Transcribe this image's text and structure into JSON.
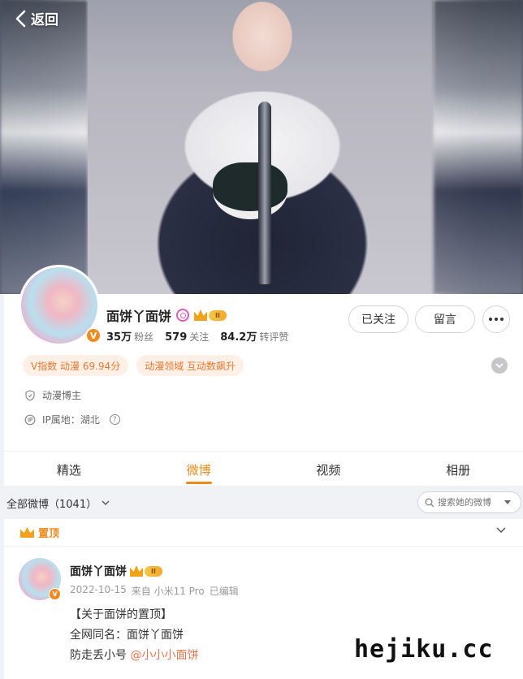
{
  "nav": {
    "back_label": "返回"
  },
  "profile": {
    "name": "面饼丫面饼",
    "verified_mark": "V",
    "vip_level": "II",
    "stats": [
      {
        "value": "35万",
        "label": "粉丝"
      },
      {
        "value": "579",
        "label": "关注"
      },
      {
        "value": "84.2万",
        "label": "转评赞"
      }
    ],
    "follow_button": "已关注",
    "message_button": "留言",
    "tags": [
      "V指数 动漫 69.94分",
      "动漫领域 互动数飙升"
    ],
    "role": "动漫博主",
    "ip_location": "IP属地：湖北",
    "help_mark": "?"
  },
  "tabs": [
    {
      "label": "精选",
      "active": false
    },
    {
      "label": "微博",
      "active": true
    },
    {
      "label": "视频",
      "active": false
    },
    {
      "label": "相册",
      "active": false
    }
  ],
  "filter": {
    "all_posts_label": "全部微博（1041）",
    "search_placeholder": "搜索她的微博"
  },
  "pinned_post": {
    "section_label": "置顶",
    "author": "面饼丫面饼",
    "vip_level": "II",
    "verified_mark": "V",
    "date": "2022-10-15",
    "source": "来自 小米11 Pro",
    "edited": "已编辑",
    "lines": [
      "【关于面饼的置顶】",
      "全网同名：面饼丫面饼"
    ],
    "last_line_prefix": "防走丢小号 ",
    "mention": "@小小小面饼"
  },
  "watermark": "hejiku.cc",
  "colors": {
    "accent": "#f08a1d",
    "tag_bg": "#fef0e7",
    "mention": "#eb7350"
  }
}
